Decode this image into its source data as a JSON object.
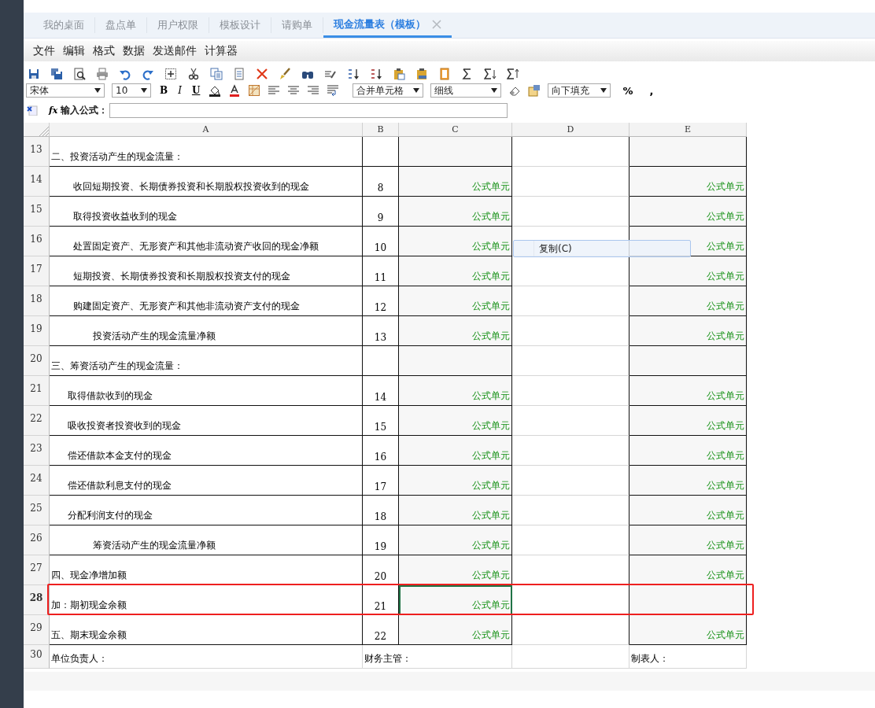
{
  "tabs": [
    {
      "label": "我的桌面",
      "selected": false
    },
    {
      "label": "盘点单",
      "selected": false
    },
    {
      "label": "用户权限",
      "selected": false
    },
    {
      "label": "模板设计",
      "selected": false
    },
    {
      "label": "请购单",
      "selected": false
    },
    {
      "label": "现金流量表（模板）",
      "selected": true
    }
  ],
  "menu": [
    "文件",
    "编辑",
    "格式",
    "数据",
    "发送邮件",
    "计算器"
  ],
  "toolbar": {
    "font": "宋体",
    "size": "10",
    "format_buttons": [
      "B",
      "I",
      "U"
    ],
    "merge": "合并单元格",
    "line": "细线",
    "fill": "向下填充",
    "number_buttons": [
      "%",
      ","
    ]
  },
  "formula_bar": {
    "fx": "fx",
    "label": "输入公式："
  },
  "sheet": {
    "columns": [
      "A",
      "B",
      "C",
      "D",
      "E"
    ],
    "rows": [
      {
        "num": "13",
        "kind": "section",
        "a": "二、投资活动产生的现金流量：",
        "b": "",
        "c": "",
        "e": "",
        "selected": false,
        "marked": false
      },
      {
        "num": "14",
        "kind": "item",
        "a": "收回短期投资、长期债券投资和长期股权投资收到的现金",
        "b": "8",
        "c": "公式单元",
        "e": "公式单元",
        "selected": false,
        "marked": false
      },
      {
        "num": "15",
        "kind": "item",
        "a": "取得投资收益收到的现金",
        "b": "9",
        "c": "公式单元",
        "e": "公式单元",
        "selected": false,
        "marked": false
      },
      {
        "num": "16",
        "kind": "item",
        "a": "处置固定资产、无形资产和其他非流动资产收回的现金净额",
        "b": "10",
        "c": "公式单元",
        "e": "公式单元",
        "selected": false,
        "marked": false
      },
      {
        "num": "17",
        "kind": "item",
        "a": "短期投资、长期债券投资和长期股权投资支付的现金",
        "b": "11",
        "c": "公式单元",
        "e": "公式单元",
        "selected": false,
        "marked": false
      },
      {
        "num": "18",
        "kind": "item",
        "a": "购建固定资产、无形资产和其他非流动资产支付的现金",
        "b": "12",
        "c": "公式单元",
        "e": "公式单元",
        "selected": false,
        "marked": false
      },
      {
        "num": "19",
        "kind": "subtotal",
        "a": "投资活动产生的现金流量净额",
        "b": "13",
        "c": "公式单元",
        "e": "公式单元",
        "selected": false,
        "marked": false
      },
      {
        "num": "20",
        "kind": "section",
        "a": "三、筹资活动产生的现金流量：",
        "b": "",
        "c": "",
        "e": "",
        "selected": false,
        "marked": false
      },
      {
        "num": "21",
        "kind": "item2",
        "a": "取得借款收到的现金",
        "b": "14",
        "c": "公式单元",
        "e": "公式单元",
        "selected": false,
        "marked": false
      },
      {
        "num": "22",
        "kind": "item2",
        "a": "吸收投资者投资收到的现金",
        "b": "15",
        "c": "公式单元",
        "e": "公式单元",
        "selected": false,
        "marked": false
      },
      {
        "num": "23",
        "kind": "item2",
        "a": "偿还借款本金支付的现金",
        "b": "16",
        "c": "公式单元",
        "e": "公式单元",
        "selected": false,
        "marked": false
      },
      {
        "num": "24",
        "kind": "item2",
        "a": "偿还借款利息支付的现金",
        "b": "17",
        "c": "公式单元",
        "e": "公式单元",
        "selected": false,
        "marked": false
      },
      {
        "num": "25",
        "kind": "item2",
        "a": "分配利润支付的现金",
        "b": "18",
        "c": "公式单元",
        "e": "公式单元",
        "selected": false,
        "marked": false
      },
      {
        "num": "26",
        "kind": "subtotal",
        "a": "筹资活动产生的现金流量净额",
        "b": "19",
        "c": "公式单元",
        "e": "公式单元",
        "selected": false,
        "marked": false
      },
      {
        "num": "27",
        "kind": "section",
        "a": "四、现金净增加额",
        "b": "20",
        "c": "公式单元",
        "e": "公式单元",
        "selected": false,
        "marked": false
      },
      {
        "num": "28",
        "kind": "section",
        "a": "加：期初现金余额",
        "b": "21",
        "c": "公式单元",
        "e": "",
        "selected": true,
        "marked": true
      },
      {
        "num": "29",
        "kind": "section",
        "a": "五、期末现金余额",
        "b": "22",
        "c": "公式单元",
        "e": "公式单元",
        "selected": false,
        "marked": false
      },
      {
        "num": "30",
        "kind": "footer",
        "a": "单位负责人：",
        "b": "财务主管：",
        "c": "",
        "e": "制表人：",
        "selected": false,
        "marked": false
      }
    ]
  },
  "context_menu": {
    "items": [
      {
        "label": "复制(C)"
      }
    ]
  }
}
